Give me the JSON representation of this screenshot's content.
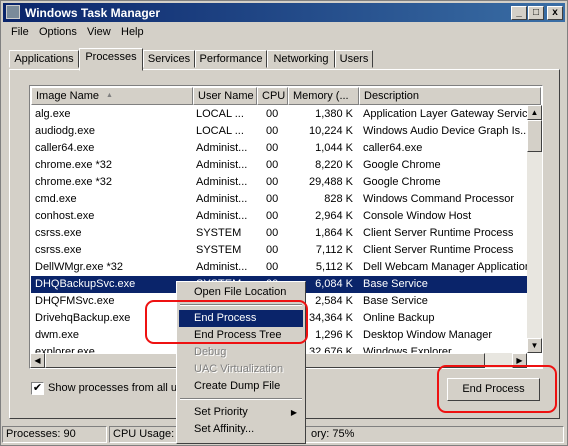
{
  "window": {
    "title": "Windows Task Manager",
    "minimize": "_",
    "maximize": "□",
    "close": "x"
  },
  "menu": [
    "File",
    "Options",
    "View",
    "Help"
  ],
  "tabs": [
    "Applications",
    "Processes",
    "Services",
    "Performance",
    "Networking",
    "Users"
  ],
  "active_tab": "Processes",
  "columns": [
    "Image Name",
    "User Name",
    "CPU",
    "Memory (...",
    "Description"
  ],
  "sort_indicator": "▲",
  "rows": [
    {
      "name": "alg.exe",
      "user": "LOCAL ...",
      "cpu": "00",
      "mem": "1,380 K",
      "desc": "Application Layer Gateway Service"
    },
    {
      "name": "audiodg.exe",
      "user": "LOCAL ...",
      "cpu": "00",
      "mem": "10,224 K",
      "desc": "Windows Audio Device Graph Is..."
    },
    {
      "name": "caller64.exe",
      "user": "Administ...",
      "cpu": "00",
      "mem": "1,044 K",
      "desc": "caller64.exe"
    },
    {
      "name": "chrome.exe *32",
      "user": "Administ...",
      "cpu": "00",
      "mem": "8,220 K",
      "desc": "Google Chrome"
    },
    {
      "name": "chrome.exe *32",
      "user": "Administ...",
      "cpu": "00",
      "mem": "29,488 K",
      "desc": "Google Chrome"
    },
    {
      "name": "cmd.exe",
      "user": "Administ...",
      "cpu": "00",
      "mem": "828 K",
      "desc": "Windows Command Processor"
    },
    {
      "name": "conhost.exe",
      "user": "Administ...",
      "cpu": "00",
      "mem": "2,964 K",
      "desc": "Console Window Host"
    },
    {
      "name": "csrss.exe",
      "user": "SYSTEM",
      "cpu": "00",
      "mem": "1,864 K",
      "desc": "Client Server Runtime Process"
    },
    {
      "name": "csrss.exe",
      "user": "SYSTEM",
      "cpu": "00",
      "mem": "7,112 K",
      "desc": "Client Server Runtime Process"
    },
    {
      "name": "DellWMgr.exe *32",
      "user": "Administ...",
      "cpu": "00",
      "mem": "5,112 K",
      "desc": "Dell Webcam Manager Application"
    },
    {
      "name": "DHQBackupSvc.exe",
      "user": "SYSTEM",
      "cpu": "00",
      "mem": "6,084 K",
      "desc": "Base Service"
    },
    {
      "name": "DHQFMSvc.exe",
      "user": "",
      "cpu": "",
      "mem": "2,584 K",
      "desc": "Base Service"
    },
    {
      "name": "DrivehqBackup.exe",
      "user": "",
      "cpu": "",
      "mem": "34,364 K",
      "desc": "Online Backup"
    },
    {
      "name": "dwm.exe",
      "user": "",
      "cpu": "",
      "mem": "1,296 K",
      "desc": "Desktop Window Manager"
    },
    {
      "name": "explorer.exe",
      "user": "",
      "cpu": "",
      "mem": "32,676 K",
      "desc": "Windows Explorer"
    }
  ],
  "selected_row": 10,
  "show_all_label": "Show processes from all us",
  "show_all_checked": "✔",
  "end_process_button": "End Process",
  "context_menu": {
    "open_file_location": "Open File Location",
    "end_process": "End Process",
    "end_process_tree": "End Process Tree",
    "debug": "Debug",
    "uac_virtualization": "UAC Virtualization",
    "create_dump_file": "Create Dump File",
    "set_priority": "Set Priority",
    "set_affinity": "Set Affinity...",
    "submenu_arrow": "▶"
  },
  "status": {
    "processes": "Processes: 90",
    "cpu": "CPU Usage: 1",
    "memory": "ory: 75%"
  },
  "scroll_glyphs": {
    "up": "▲",
    "down": "▼",
    "left": "◀",
    "right": "▶"
  },
  "colors": {
    "annotation": "#e11111",
    "selection": "#0a246a",
    "titlebar": "#0a246a"
  }
}
